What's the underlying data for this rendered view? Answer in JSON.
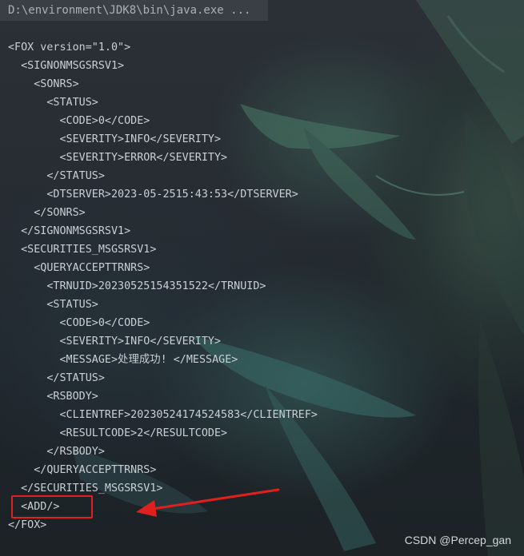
{
  "title_bar": {
    "path": "D:\\environment\\JDK8\\bin\\java.exe ..."
  },
  "xml_lines": [
    "<FOX version=\"1.0\">",
    "  <SIGNONMSGSRSV1>",
    "    <SONRS>",
    "      <STATUS>",
    "        <CODE>0</CODE>",
    "        <SEVERITY>INFO</SEVERITY>",
    "        <SEVERITY>ERROR</SEVERITY>",
    "      </STATUS>",
    "      <DTSERVER>2023-05-2515:43:53</DTSERVER>",
    "    </SONRS>",
    "  </SIGNONMSGSRSV1>",
    "  <SECURITIES_MSGSRSV1>",
    "    <QUERYACCEPTTRNRS>",
    "      <TRNUID>20230525154351522</TRNUID>",
    "      <STATUS>",
    "        <CODE>0</CODE>",
    "        <SEVERITY>INFO</SEVERITY>",
    "        <MESSAGE>处理成功! </MESSAGE>",
    "      </STATUS>",
    "      <RSBODY>",
    "        <CLIENTREF>20230524174524583</CLIENTREF>",
    "        <RESULTCODE>2</RESULTCODE>",
    "      </RSBODY>",
    "    </QUERYACCEPTTRNRS>",
    "  </SECURITIES_MSGSRSV1>",
    "  <ADD/>",
    "</FOX>"
  ],
  "annotation": {
    "highlight_color": "#e0201e",
    "arrow_color": "#e0201e"
  },
  "watermark": "CSDN @Percep_gan"
}
